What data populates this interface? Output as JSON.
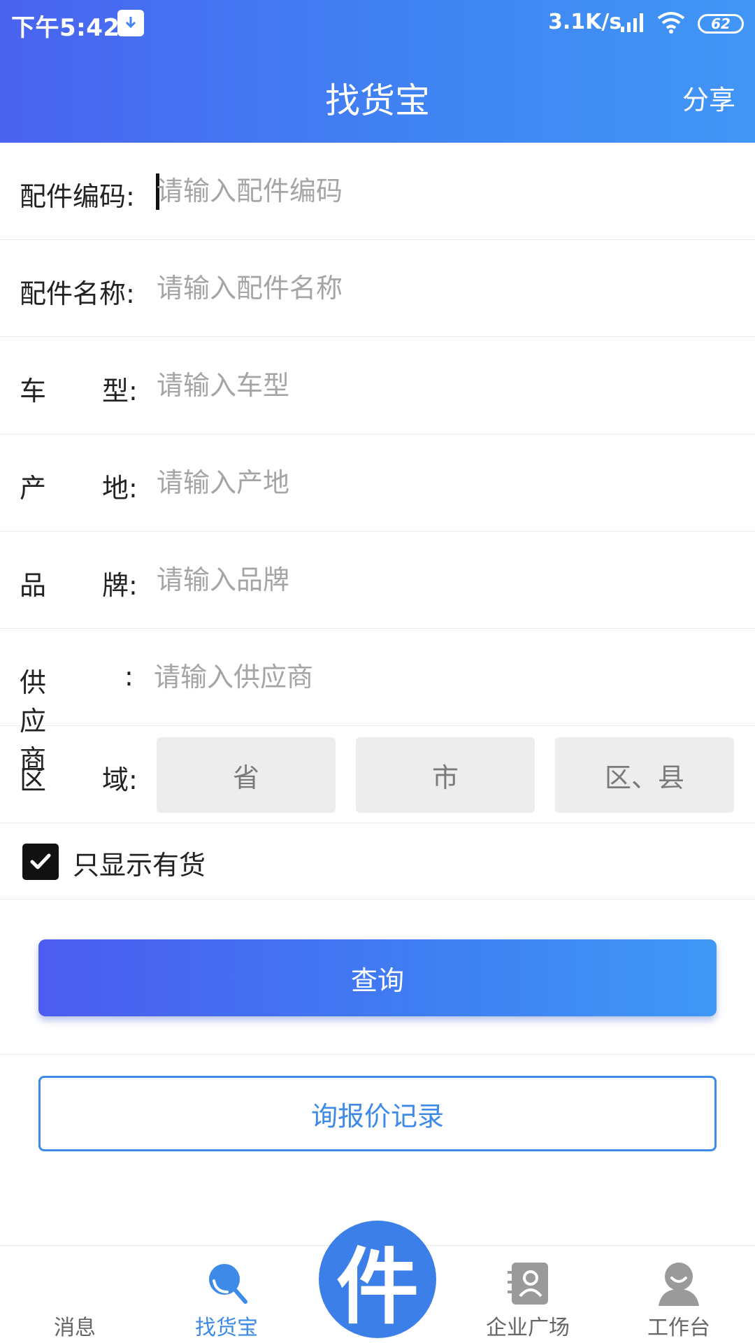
{
  "status_bar": {
    "time": "下午5:42",
    "speed": "3.1K/s",
    "battery": "62"
  },
  "header": {
    "title": "找货宝",
    "share_label": "分享"
  },
  "form": {
    "part_code": {
      "label": "配件编码:",
      "placeholder": "请输入配件编码"
    },
    "part_name": {
      "label": "配件名称:",
      "placeholder": "请输入配件名称"
    },
    "model": {
      "label_a": "车",
      "label_b": "型:",
      "placeholder": "请输入车型"
    },
    "origin": {
      "label_a": "产",
      "label_b": "地:",
      "placeholder": "请输入产地"
    },
    "brand": {
      "label_a": "品",
      "label_b": "牌:",
      "placeholder": "请输入品牌"
    },
    "supplier": {
      "label_a": "供应商",
      "label_b": ":",
      "placeholder": "请输入供应商"
    },
    "region": {
      "label_a": "区",
      "label_b": "域:",
      "province": "省",
      "city": "市",
      "district": "区、县"
    }
  },
  "only_in_stock": {
    "label": "只显示有货",
    "checked": true
  },
  "buttons": {
    "query": "查询",
    "records": "询报价记录"
  },
  "bottom_nav": {
    "messages": "消息",
    "find_goods": "找货宝",
    "center": "件",
    "enterprise": "企业广场",
    "workbench": "工作台"
  },
  "colors": {
    "accent": "#3d8ae8",
    "header_gradient_start": "#4a63f0",
    "header_gradient_end": "#4196f5"
  }
}
